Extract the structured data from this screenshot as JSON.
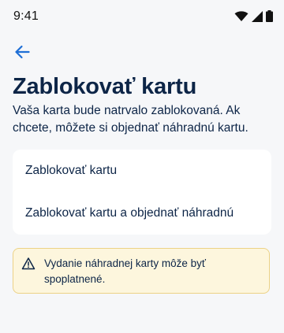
{
  "status_bar": {
    "time": "9:41"
  },
  "header": {
    "back_icon": "arrow-left-icon",
    "title": "Zablokovať kartu",
    "subtitle": "Vaša karta bude natrvalo zablokovaná. Ak chcete, môžete si objednať náhradnú kartu."
  },
  "options": [
    {
      "label": "Zablokovať kartu"
    },
    {
      "label": "Zablokovať kartu a objednať náhradnú"
    }
  ],
  "warning": {
    "icon": "warning-triangle-icon",
    "text": "Vydanie náhradnej karty môže byť spoplatnené."
  },
  "colors": {
    "background": "#f6f7f9",
    "text": "#0d2547",
    "accent": "#1f6fd6",
    "warning_bg": "#fdf6dd",
    "warning_border": "#ecd286"
  }
}
